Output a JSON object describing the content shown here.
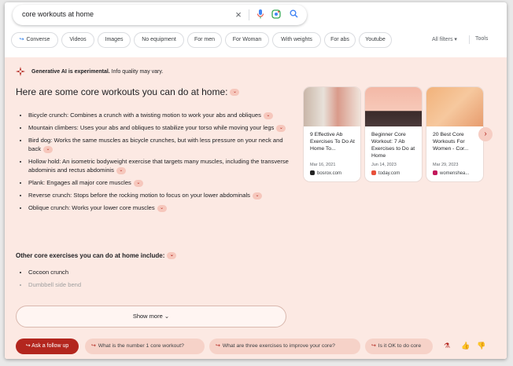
{
  "search": {
    "query": "core workouts at home"
  },
  "chips": [
    "Converse",
    "Videos",
    "Images",
    "No equipment",
    "For men",
    "For Woman",
    "With weights",
    "For abs",
    "Youtube"
  ],
  "filters": {
    "all_filters": "All filters",
    "tools": "Tools"
  },
  "ai_notice": {
    "bold": "Generative AI is experimental.",
    "rest": " Info quality may vary."
  },
  "title": "Here are some core workouts you can do at home:",
  "workouts": [
    "Bicycle crunch: Combines a crunch with a twisting motion to work your abs and obliques",
    "Mountain climbers: Uses your abs and obliques to stabilize your torso while moving your legs",
    "Bird dog: Works the same muscles as bicycle crunches, but with less pressure on your neck and back",
    "Hollow hold: An isometric bodyweight exercise that targets many muscles, including the transverse abdominis and rectus abdominis",
    "Plank: Engages all major core muscles",
    "Reverse crunch: Stops before the rocking motion to focus on your lower abdominals",
    "Oblique crunch: Works your lower core muscles"
  ],
  "other_heading": "Other core exercises you can do at home include:",
  "other": [
    "Cocoon crunch",
    "Dumbbell side bend"
  ],
  "show_more": "Show more",
  "cards": [
    {
      "title": "9 Effective Ab Exercises To Do At Home To...",
      "date": "Mar 16, 2021",
      "source": "bosrox.com"
    },
    {
      "title": "Beginner Core Workout: 7 Ab Exercises to Do at Home",
      "date": "Jun 14, 2023",
      "source": "today.com"
    },
    {
      "title": "20 Best Core Workouts For Women - Cor...",
      "date": "Mar 29, 2023",
      "source": "womenshea..."
    }
  ],
  "followup": {
    "ask": "Ask a follow up",
    "questions": [
      "What is the number 1 core workout?",
      "What are three exercises to improve your core?",
      "Is it OK to do core"
    ]
  },
  "colors": {
    "accent": "#b3261e",
    "ai_bg": "#fce9e3",
    "chip_border": "#dadce0"
  }
}
